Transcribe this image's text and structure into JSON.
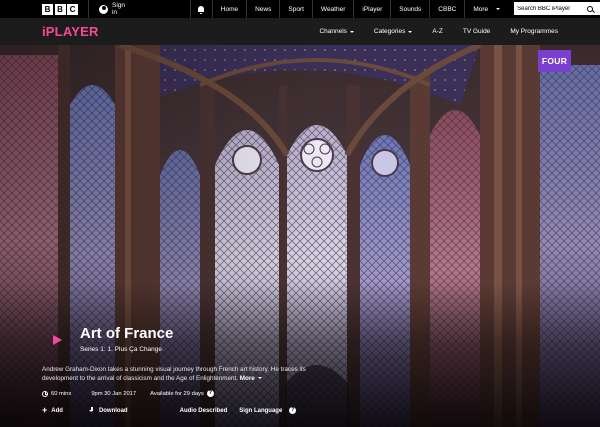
{
  "bbc_bar": {
    "logo_letters": [
      "B",
      "B",
      "C"
    ],
    "signin_label": "Sign in",
    "nav": [
      "Home",
      "News",
      "Sport",
      "Weather",
      "iPlayer",
      "Sounds",
      "CBBC"
    ],
    "more_label": "More",
    "search_placeholder": "Search BBC iPlayer",
    "icons": {
      "account": "avatar-icon",
      "notifications": "bell-icon",
      "search": "search-icon"
    }
  },
  "iplayer_header": {
    "logo": "iPLAYER",
    "brand_color": "#f54997",
    "nav": {
      "channels": "Channels",
      "categories": "Categories",
      "az": "A-Z",
      "tv_guide": "TV Guide",
      "my_programmes": "My Programmes"
    }
  },
  "hero": {
    "channel_badge": "FOUR",
    "channel_color": "#7a3fcf",
    "title": "Art of France",
    "subtitle": "Series 1: 1. Plus Ça Change",
    "synopsis": "Andrew Graham-Dixon takes a stunning visual journey through French art history. He traces its development to the arrival of classicism and the Age of Enlightenment.",
    "more_label": "More",
    "duration": "60 mins",
    "aired": "9pm 30 Jan 2017",
    "availability": "Available for 29 days",
    "actions": {
      "add": "Add",
      "download": "Download",
      "audio_described": "Audio Described",
      "sign_language": "Sign Language"
    },
    "icons": {
      "play": "play-icon",
      "duration": "clock-icon",
      "info": "info-icon",
      "add": "plus-icon",
      "download": "download-icon"
    }
  }
}
